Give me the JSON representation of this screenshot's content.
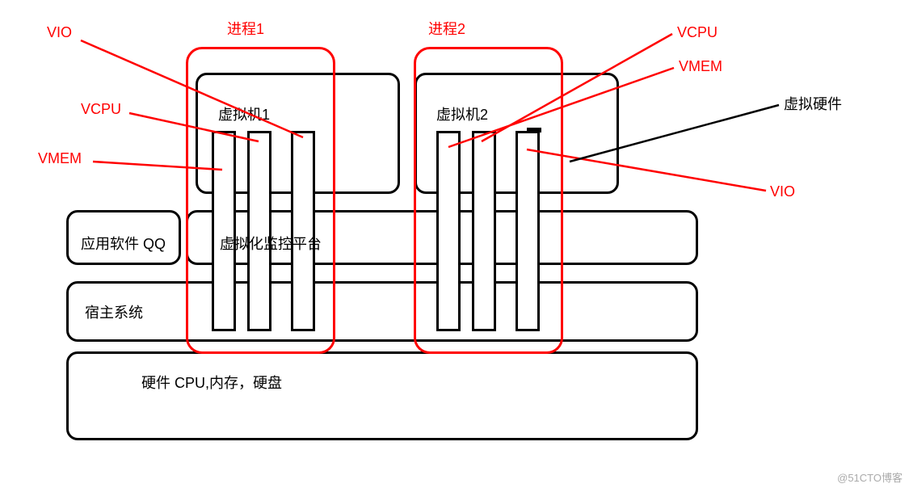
{
  "labels": {
    "vio_left": "VIO",
    "vcpu_left": "VCPU",
    "vmem_left": "VMEM",
    "process1": "进程1",
    "process2": "进程2",
    "vcpu_right": "VCPU",
    "vmem_right": "VMEM",
    "virtual_hw": "虚拟硬件",
    "vio_right": "VIO",
    "vm1": "虚拟机1",
    "vm2": "虚拟机2",
    "app_qq": "应用软件 QQ",
    "monitor_platform": "虚拟化监控平台",
    "host_system": "宿主系统",
    "hw_line": "硬件    CPU,内存，硬盘",
    "watermark": "@51CTO博客"
  }
}
